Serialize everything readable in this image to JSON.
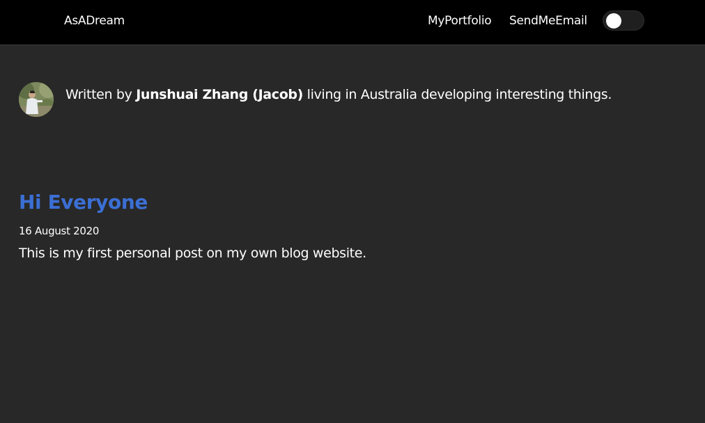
{
  "navbar": {
    "brand": "AsADream",
    "links": [
      {
        "label": "MyPortfolio"
      },
      {
        "label": "SendMeEmail"
      }
    ],
    "theme_toggle": {
      "state": "off"
    }
  },
  "bio": {
    "prefix": "Written by ",
    "author": "Junshuai Zhang (Jacob)",
    "suffix": " living in Australia developing interesting things."
  },
  "post": {
    "title": "Hi Everyone",
    "date": "16 August 2020",
    "excerpt": "This is my first personal post on my own blog website."
  },
  "colors": {
    "background": "#282828",
    "navbar": "#000000",
    "title_accent": "#3b6fd4",
    "text": "#ffffff"
  }
}
